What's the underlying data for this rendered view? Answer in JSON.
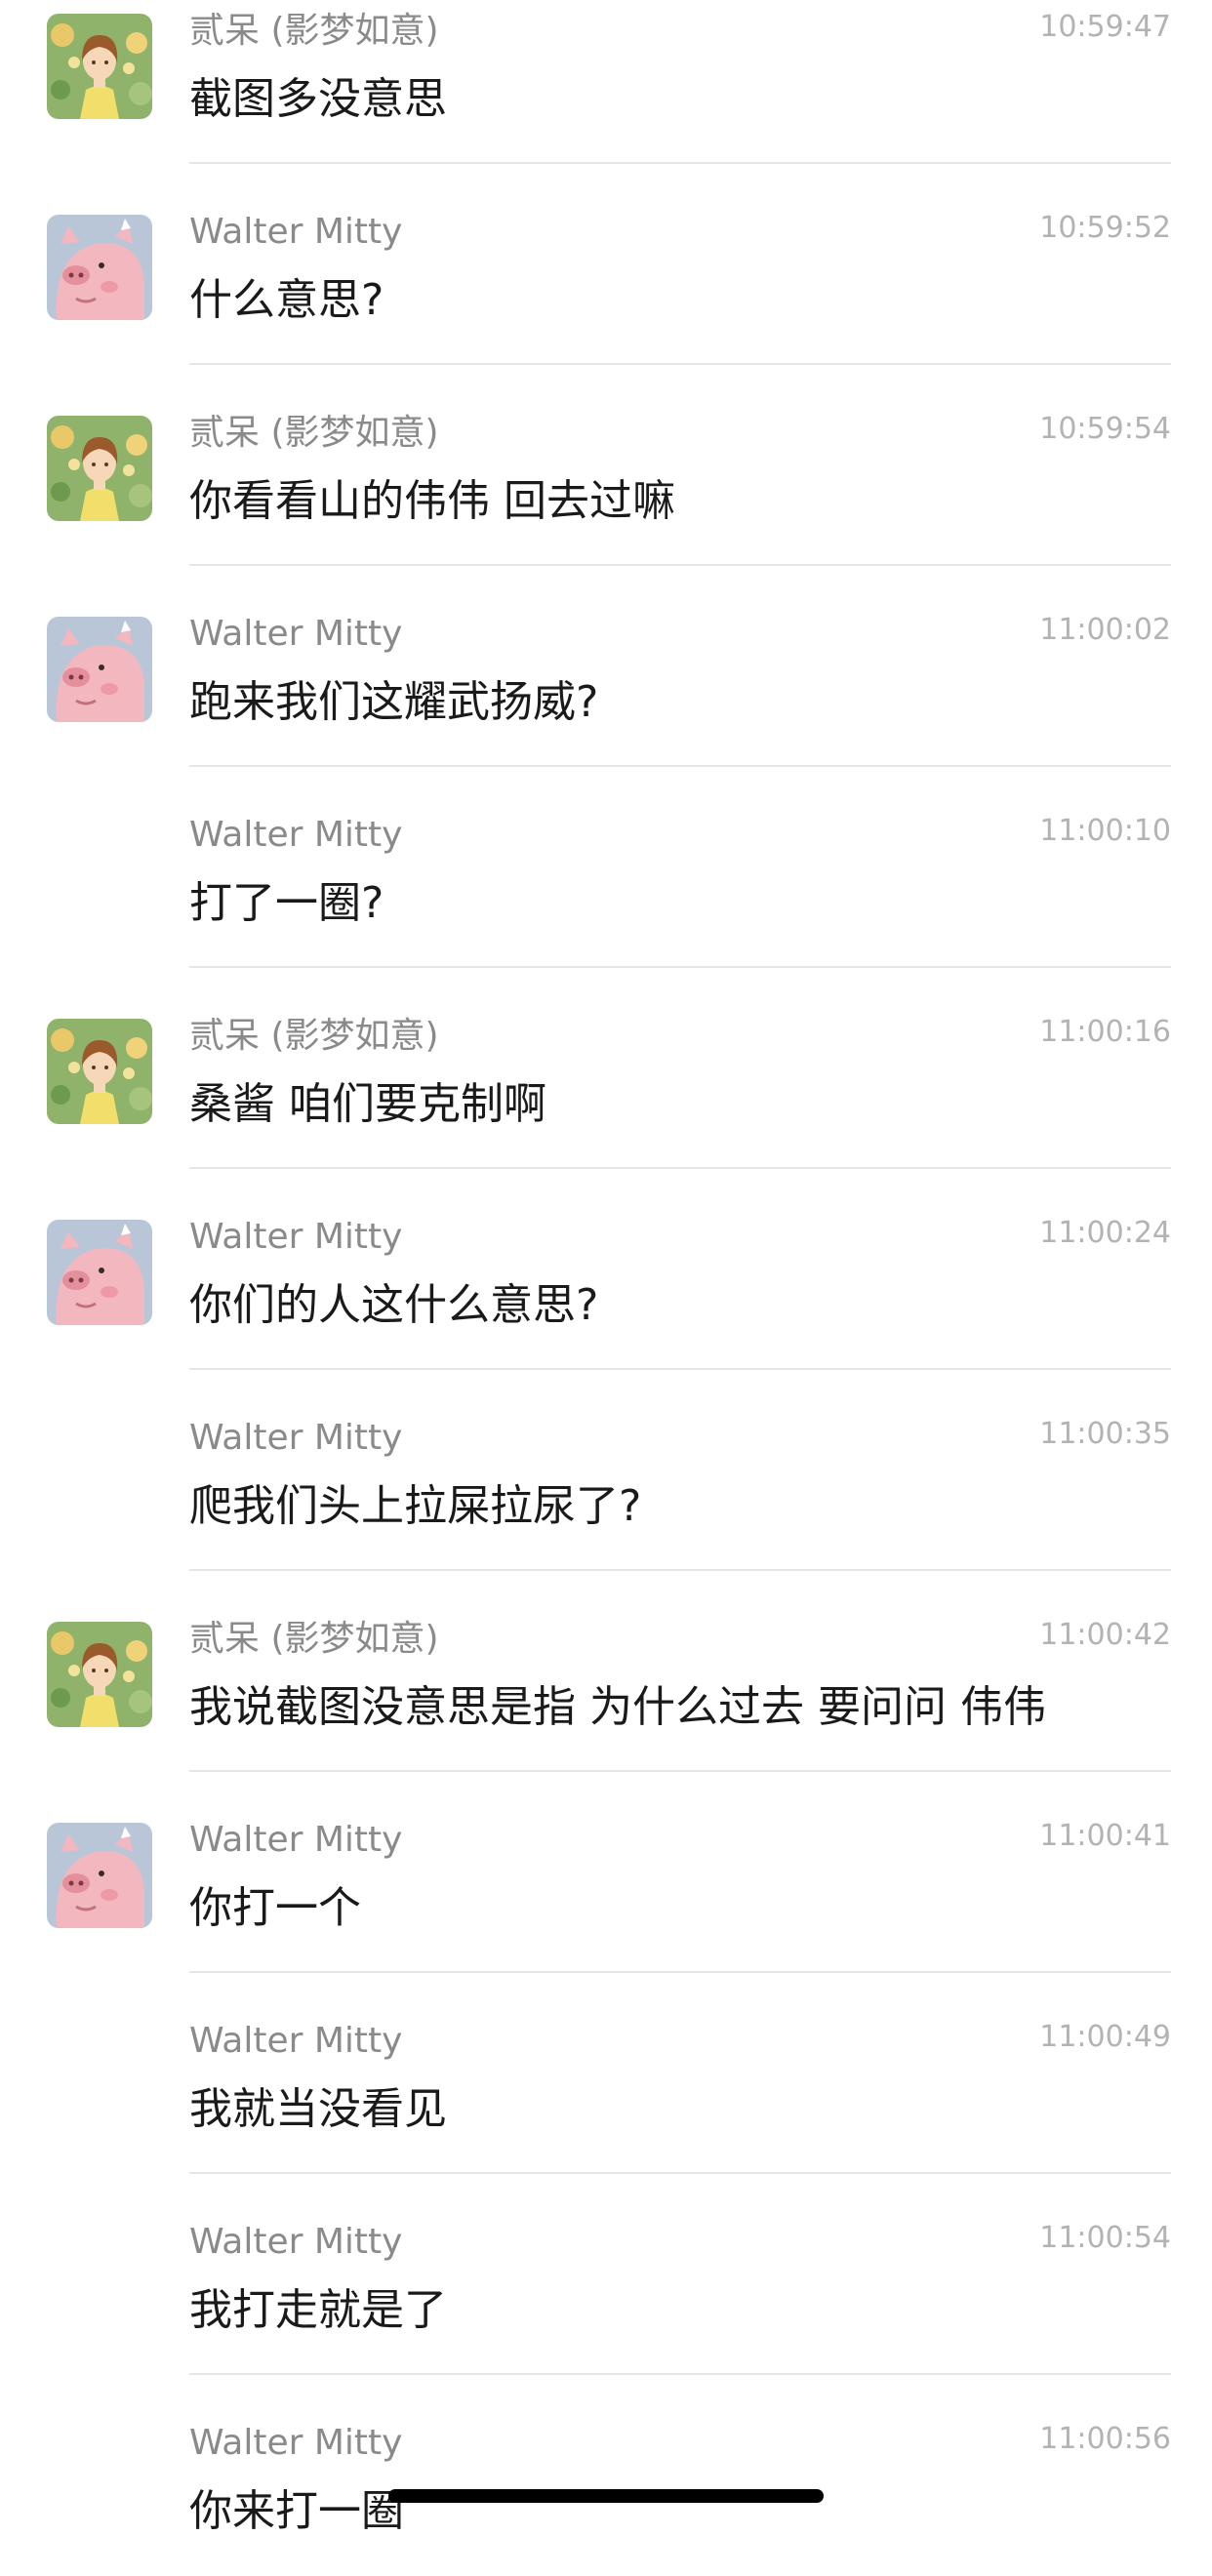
{
  "messages": [
    {
      "sender": "贰呆 (影梦如意)",
      "time": "10:59:47",
      "text": "截图多没意思",
      "avatar": "girl-avatar"
    },
    {
      "sender": "Walter Mitty",
      "time": "10:59:52",
      "text": "什么意思?",
      "avatar": "pig-avatar"
    },
    {
      "sender": "贰呆 (影梦如意)",
      "time": "10:59:54",
      "text": "你看看山的伟伟 回去过嘛",
      "avatar": "girl-avatar"
    },
    {
      "sender": "Walter Mitty",
      "time": "11:00:02",
      "text": "跑来我们这耀武扬威?",
      "avatar": "pig-avatar"
    },
    {
      "sender": "Walter Mitty",
      "time": "11:00:10",
      "text": "打了一圈?",
      "avatar": ""
    },
    {
      "sender": "贰呆 (影梦如意)",
      "time": "11:00:16",
      "text": "桑酱 咱们要克制啊",
      "avatar": "girl-avatar"
    },
    {
      "sender": "Walter Mitty",
      "time": "11:00:24",
      "text": "你们的人这什么意思?",
      "avatar": "pig-avatar"
    },
    {
      "sender": "Walter Mitty",
      "time": "11:00:35",
      "text": "爬我们头上拉屎拉尿了?",
      "avatar": ""
    },
    {
      "sender": "贰呆 (影梦如意)",
      "time": "11:00:42",
      "text": "我说截图没意思是指 为什么过去 要问问 伟伟",
      "avatar": "girl-avatar"
    },
    {
      "sender": "Walter Mitty",
      "time": "11:00:41",
      "text": "你打一个",
      "avatar": "pig-avatar"
    },
    {
      "sender": "Walter Mitty",
      "time": "11:00:49",
      "text": "我就当没看见",
      "avatar": ""
    },
    {
      "sender": "Walter Mitty",
      "time": "11:00:54",
      "text": "我打走就是了",
      "avatar": ""
    },
    {
      "sender": "Walter Mitty",
      "time": "11:00:56",
      "text": "你来打一圈",
      "avatar": ""
    }
  ],
  "colors": {
    "background": "#ffffff",
    "sender_text": "#8a8a8a",
    "time_text": "#b3b3b3",
    "message_text": "#1a1a1a",
    "divider": "#e6e6e6"
  }
}
